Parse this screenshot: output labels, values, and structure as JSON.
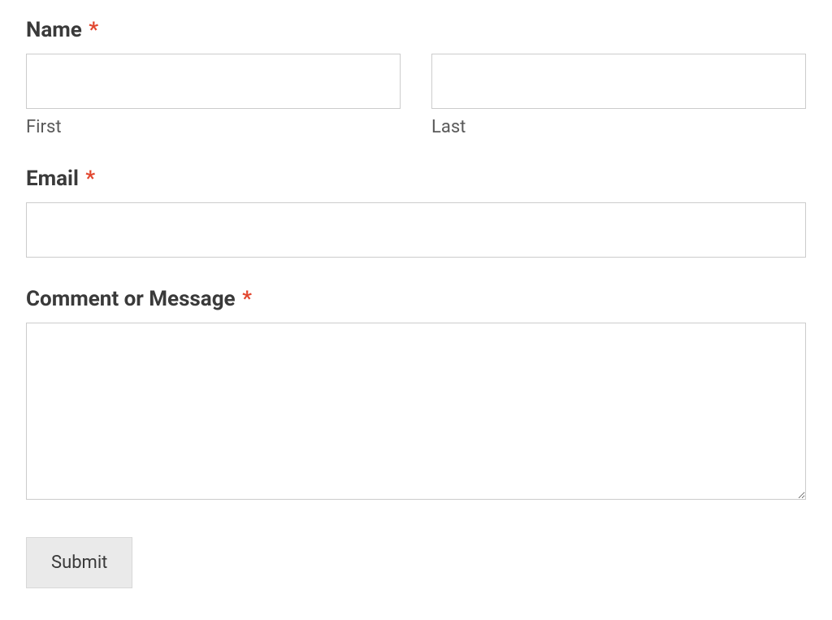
{
  "form": {
    "name": {
      "label": "Name",
      "required": "*",
      "first": {
        "value": "",
        "sublabel": "First"
      },
      "last": {
        "value": "",
        "sublabel": "Last"
      }
    },
    "email": {
      "label": "Email",
      "required": "*",
      "value": ""
    },
    "message": {
      "label": "Comment or Message",
      "required": "*",
      "value": ""
    },
    "submit": {
      "label": "Submit"
    }
  }
}
